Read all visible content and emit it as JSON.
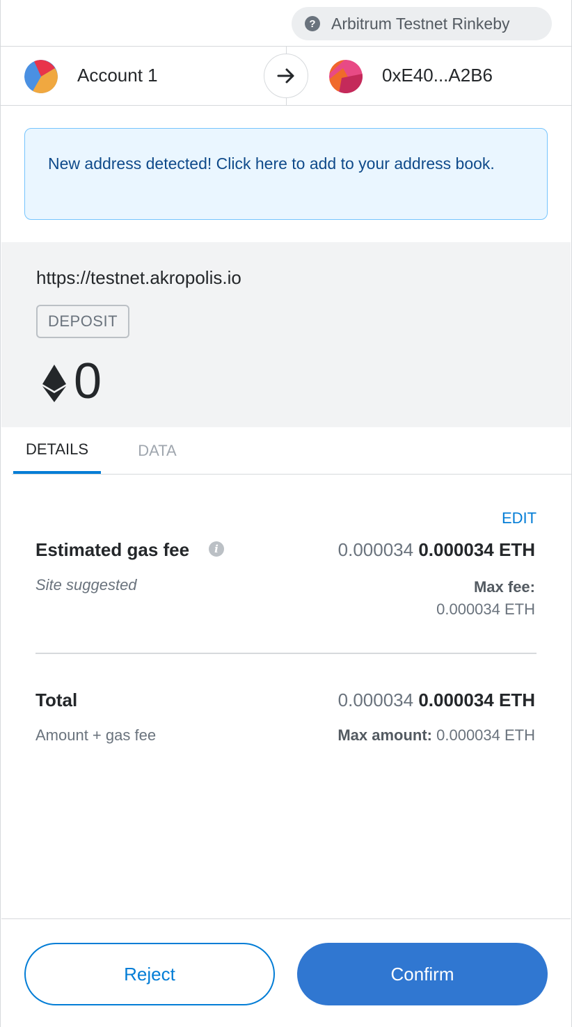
{
  "network": {
    "label": "Arbitrum Testnet Rinkeby",
    "icon": "question-icon"
  },
  "account": {
    "from_name": "Account 1",
    "to_address": "0xE40...A2B6"
  },
  "banner": {
    "text": "New address detected! Click here to add to your address book."
  },
  "summary": {
    "origin": "https://testnet.akropolis.io",
    "method_tag": "DEPOSIT",
    "amount": "0"
  },
  "tabs": [
    {
      "label": "DETAILS",
      "active": true
    },
    {
      "label": "DATA",
      "active": false
    }
  ],
  "details": {
    "edit_label": "EDIT",
    "gas": {
      "label": "Estimated gas fee",
      "value_secondary": "0.000034",
      "value_primary": "0.000034 ETH",
      "sub_label": "Site suggested",
      "max_fee_label": "Max fee:",
      "max_fee_value": "0.000034 ETH"
    },
    "total": {
      "label": "Total",
      "value_secondary": "0.000034",
      "value_primary": "0.000034 ETH",
      "sub_label": "Amount + gas fee",
      "max_amount_label": "Max amount:",
      "max_amount_value": "0.000034 ETH"
    }
  },
  "footer": {
    "reject_label": "Reject",
    "confirm_label": "Confirm"
  },
  "colors": {
    "accent": "#037dd6",
    "confirm_bg": "#3077d1",
    "banner_bg": "#eaf6ff"
  }
}
